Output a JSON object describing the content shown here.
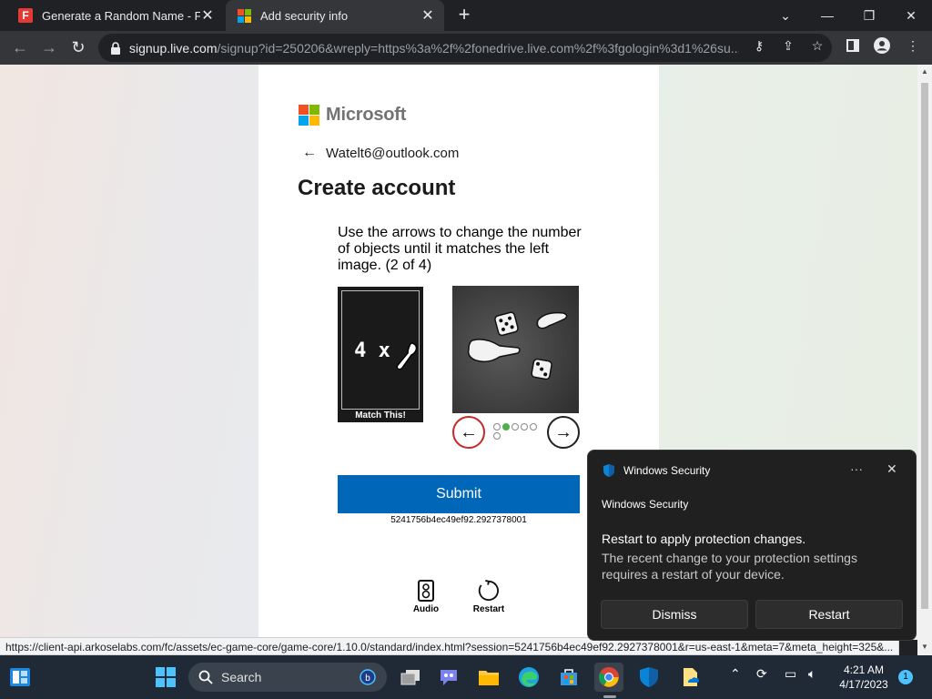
{
  "browser": {
    "tabs": [
      {
        "title": "Generate a Random Name - Fake",
        "close": "✕"
      },
      {
        "title": "Add security info",
        "close": "✕"
      }
    ],
    "url_host": "signup.live.com",
    "url_path": "/signup?id=250206&wreply=https%3a%2f%2fonedrive.live.com%2f%3fgologin%3d1%26su..."
  },
  "page": {
    "brand": "Microsoft",
    "email": "Watelt6@outlook.com",
    "title": "Create account",
    "prompt": "Use the arrows to change the number of objects until it matches the left image. (2 of 4)",
    "match_text": "4 x",
    "match_caption": "Match This!",
    "submit_label": "Submit",
    "session_id": "5241756b4ec49ef92.2927378001",
    "audio_label": "Audio",
    "restart_label": "Restart",
    "pager_total": 5,
    "pager_current": 2
  },
  "status_url": "https://client-api.arkoselabs.com/fc/assets/ec-game-core/game-core/1.10.0/standard/index.html?session=5241756b4ec49ef92.2927378001&r=us-east-1&meta=7&meta_height=325&...",
  "toast": {
    "app_name": "Windows Security",
    "source": "Windows Security",
    "heading": "Restart to apply protection changes.",
    "body": "The recent change to your protection settings requires a restart of your device.",
    "dismiss_label": "Dismiss",
    "restart_label": "Restart",
    "more": "···",
    "close": "✕"
  },
  "taskbar": {
    "search_label": "Search",
    "time": "4:21 AM",
    "date": "4/17/2023",
    "notification_count": "1"
  },
  "colors": {
    "submit_blue": "#0067b8",
    "ms_red": "#f25022",
    "ms_green": "#7fba00",
    "ms_blue": "#00a4ef",
    "ms_yellow": "#ffb900"
  }
}
